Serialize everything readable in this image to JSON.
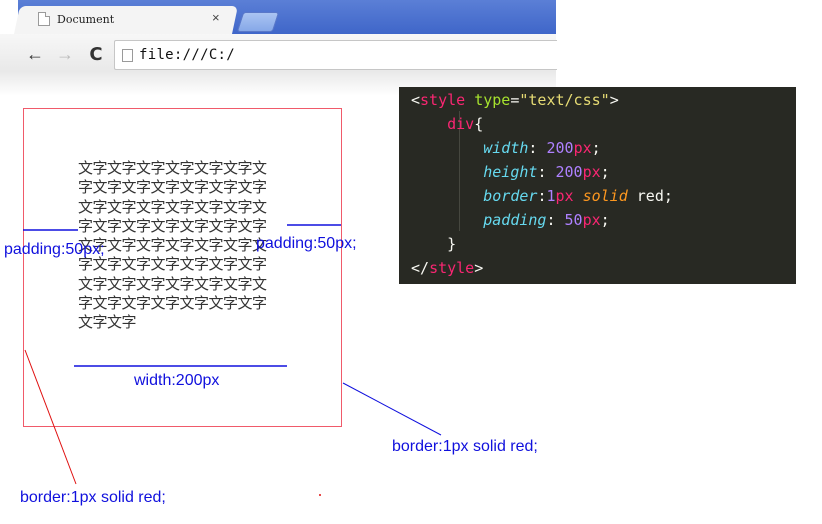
{
  "browser": {
    "tab_title": "Document",
    "tab_close_glyph": "×",
    "nav": {
      "back_glyph": "←",
      "forward_glyph": "→",
      "reload_glyph": "C"
    },
    "address": "file:///C:/"
  },
  "demo": {
    "text": "文字文字文字文字文字文字文字文字文字文字文字文字文字文字文字文字文字文字文字文字文字文字文字文字文字文字文字文字文字文字文字文字文字文字文字文字文字文字文字文字文字文字文字文字文字文字文字文字文字文字文字文字文字文字",
    "annotations": {
      "padding_left": "padding:50px;",
      "padding_right": "padding:50px;",
      "width": "width:200px",
      "border_right": "border:1px solid red;",
      "border_left": "border:1px solid red;"
    },
    "colors": {
      "border": "#f05a6a",
      "annotation": "#1010dd",
      "red_line": "#e01010"
    }
  },
  "code": {
    "open_tag_name": "style",
    "type_attr": "type",
    "type_value": "\"text/css\"",
    "selector": "div",
    "declarations": [
      {
        "prop": "width",
        "sep": ": ",
        "value_num": "200",
        "value_unit": "px",
        "value_kw": "",
        "tail": ";"
      },
      {
        "prop": "height",
        "sep": ": ",
        "value_num": "200",
        "value_unit": "px",
        "value_kw": "",
        "tail": ";"
      },
      {
        "prop": "border",
        "sep": ":",
        "value_num": "1",
        "value_unit": "px",
        "value_kw": "solid",
        "tail": " red;"
      },
      {
        "prop": "padding",
        "sep": ": ",
        "value_num": "50",
        "value_unit": "px",
        "value_kw": "",
        "tail": ";"
      }
    ],
    "close_tag_name": "style",
    "theme": {
      "background": "#282923",
      "tag": "#f92672",
      "attr": "#a6e22e",
      "string": "#e6db74",
      "property": "#66d9ef",
      "number": "#ae81ff",
      "keyword": "#fd971f"
    }
  }
}
